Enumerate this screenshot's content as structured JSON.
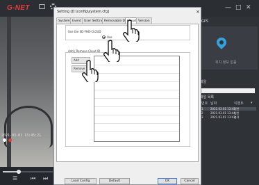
{
  "app": {
    "logo": "G-NET",
    "window_controls": [
      "—",
      "□",
      "✕"
    ]
  },
  "camera": {
    "timestamp": "2021-03-01 13:45:21"
  },
  "player_controls": [
    "☰",
    "⏮",
    "⏭"
  ],
  "right_panel": {
    "gps_label": "GPS",
    "map_text": "위치 정보 없음",
    "section_label": "파일",
    "list_label": "파일 목록",
    "list_header": [
      "번호",
      "날짜",
      "이벤트",
      "▾"
    ],
    "rows": [
      {
        "no": "1",
        "date": "2021.03.01 13:45",
        "type": "일반",
        "selected": true
      },
      {
        "no": "2",
        "date": "2021.03.01 13:44",
        "type": "일반",
        "selected": false
      },
      {
        "no": "3",
        "date": "2021.03.01 13:43",
        "type": "충격",
        "selected": false
      }
    ]
  },
  "dialog": {
    "title": "Setting [D:\\config\\system.cfg]",
    "close": "×",
    "tabs": [
      {
        "label": "System",
        "active": false
      },
      {
        "label": "Event",
        "active": false
      },
      {
        "label": "User Settings",
        "active": false
      },
      {
        "label": "Removable Disk",
        "active": false
      },
      {
        "label": "Cloud",
        "active": true
      },
      {
        "label": "Version",
        "active": false
      }
    ],
    "group1_label": "Use the SD-FHD-CLOUD",
    "radio_label": "Use",
    "group2_label": "Add / Remove Cloud ID",
    "add_button": "Add",
    "remove_button": "Remove",
    "buttons": {
      "load_config": "Load Config",
      "default": "Default",
      "ok": "OK",
      "cancel": "Cancel"
    }
  },
  "colors": {
    "logo": "#e63c3c",
    "pin": "#36a3e0",
    "dialog_bg": "#efefef"
  },
  "playback_progress": 0.32
}
